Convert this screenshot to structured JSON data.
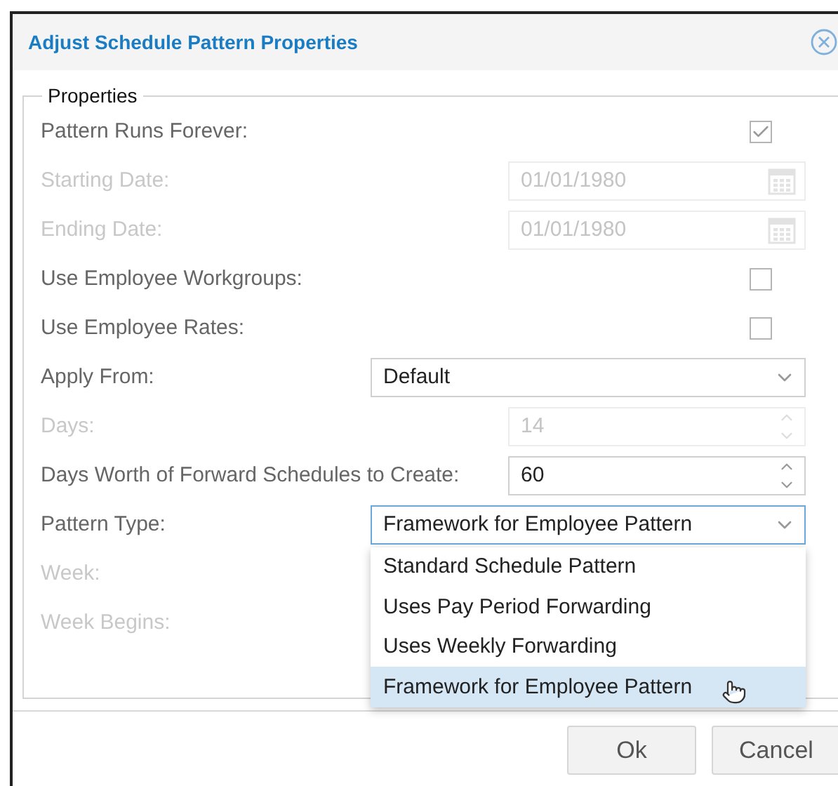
{
  "dialog": {
    "title": "Adjust Schedule Pattern Properties"
  },
  "fieldset": {
    "legend": "Properties",
    "rows": [
      {
        "kind": "checkbox",
        "label": "Pattern Runs Forever:",
        "disabled": false,
        "checked": true
      },
      {
        "kind": "date",
        "label": "Starting Date:",
        "disabled": true,
        "value": "01/01/1980"
      },
      {
        "kind": "date",
        "label": "Ending Date:",
        "disabled": true,
        "value": "01/01/1980"
      },
      {
        "kind": "checkbox",
        "label": "Use Employee Workgroups:",
        "disabled": false,
        "checked": false
      },
      {
        "kind": "checkbox",
        "label": "Use Employee Rates:",
        "disabled": false,
        "checked": false
      },
      {
        "kind": "select",
        "label": "Apply From:",
        "disabled": false,
        "value": "Default",
        "open": false
      },
      {
        "kind": "number",
        "label": "Days:",
        "disabled": true,
        "value": "14"
      },
      {
        "kind": "number",
        "label": "Days Worth of Forward Schedules to Create:",
        "disabled": false,
        "value": "60"
      },
      {
        "kind": "select",
        "label": "Pattern Type:",
        "disabled": false,
        "value": "Framework for Employee Pattern",
        "open": true,
        "options": [
          {
            "label": "Standard Schedule Pattern",
            "selected": false
          },
          {
            "label": "Uses Pay Period Forwarding",
            "selected": false
          },
          {
            "label": "Uses Weekly Forwarding",
            "selected": false
          },
          {
            "label": "Framework for Employee Pattern",
            "selected": true
          }
        ]
      },
      {
        "kind": "blank",
        "label": "Week:",
        "disabled": true
      },
      {
        "kind": "blank",
        "label": "Week Begins:",
        "disabled": true
      }
    ]
  },
  "buttons": [
    "Ok",
    "Cancel"
  ]
}
